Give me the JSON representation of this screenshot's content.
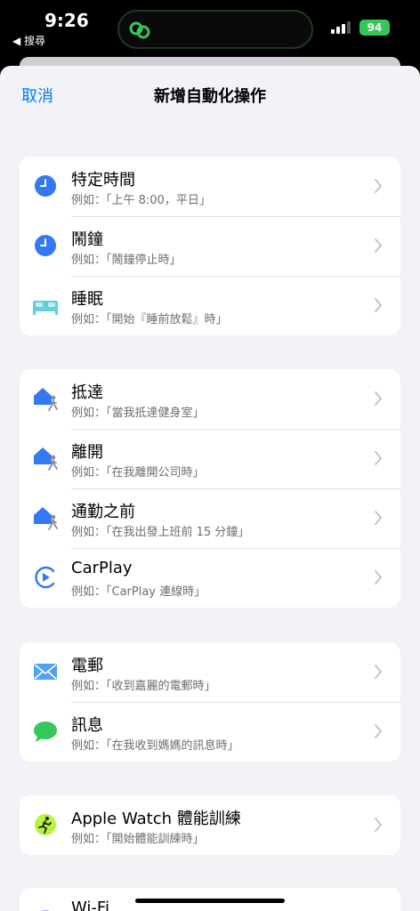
{
  "status_bar": {
    "time": "9:26",
    "back_app": "◀ 搜尋",
    "battery": "94",
    "accent": "#34c759"
  },
  "nav": {
    "cancel": "取消",
    "title": "新增自動化操作"
  },
  "sections": [
    {
      "rows": [
        {
          "icon": "clock-icon",
          "title": "特定時間",
          "subtitle": "例如：「上午 8:00，平日」"
        },
        {
          "icon": "alarm-icon",
          "title": "鬧鐘",
          "subtitle": "例如：「鬧鐘停止時」"
        },
        {
          "icon": "bed-icon",
          "title": "睡眠",
          "subtitle": "例如：「開始『睡前放鬆』時」"
        }
      ]
    },
    {
      "rows": [
        {
          "icon": "home-person-icon",
          "title": "抵達",
          "subtitle": "例如：「當我抵達健身室」"
        },
        {
          "icon": "home-person-icon",
          "title": "離開",
          "subtitle": "例如：「在我離開公司時」"
        },
        {
          "icon": "home-person-icon",
          "title": "通勤之前",
          "subtitle": "例如：「在我出發上班前 15 分鐘」"
        },
        {
          "icon": "carplay-icon",
          "title": "CarPlay",
          "subtitle": "例如：「CarPlay 連線時」"
        }
      ]
    },
    {
      "rows": [
        {
          "icon": "mail-icon",
          "title": "電郵",
          "subtitle": "例如：「收到嘉麗的電郵時」"
        },
        {
          "icon": "message-icon",
          "title": "訊息",
          "subtitle": "例如：「在我收到媽媽的訊息時」"
        }
      ]
    },
    {
      "rows": [
        {
          "icon": "workout-icon",
          "title": "Apple Watch 體能訓練",
          "subtitle": "例如：「開始體能訓練時」"
        }
      ]
    },
    {
      "rows": [
        {
          "icon": "wifi-icon",
          "title": "Wi-Fi",
          "subtitle": ""
        }
      ]
    }
  ],
  "colors": {
    "link": "#007aff",
    "background": "#f2f2f7",
    "secondary_text": "#6d6d72"
  }
}
